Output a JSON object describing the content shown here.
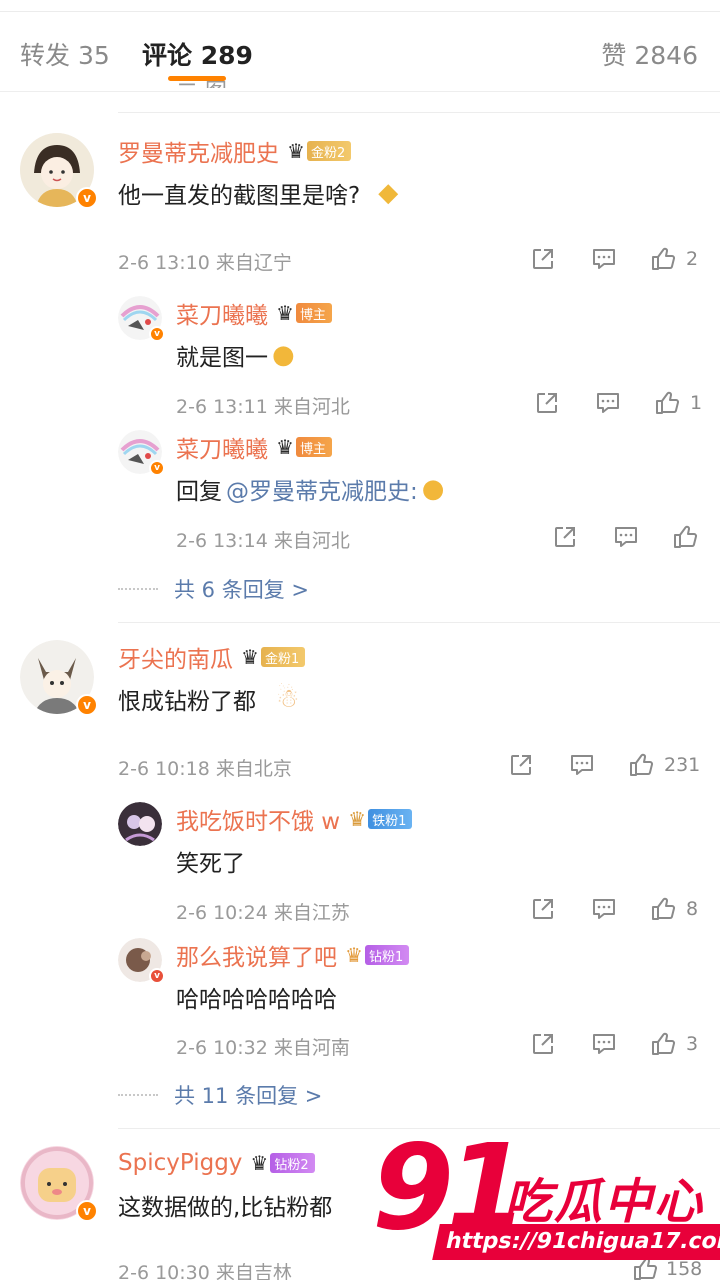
{
  "tabs": {
    "repost": "转发 35",
    "comment": "评论 289",
    "like": "赞 2846"
  },
  "cut_text": "二 图 一",
  "comments": [
    {
      "name": "罗曼蒂克减肥史",
      "badge": "金粉2",
      "text": "他一直发的截图里是啥?",
      "meta": "2-6 13:10 来自辽宁",
      "likes": "2",
      "replies": [
        {
          "name": "菜刀曦曦",
          "badge": "博主",
          "text": "就是图一",
          "meta": "2-6 13:11 来自河北",
          "likes": "1"
        },
        {
          "name": "菜刀曦曦",
          "badge": "博主",
          "text_prefix": "回复",
          "mention": "@罗曼蒂克减肥史:",
          "meta": "2-6 13:14 来自河北",
          "likes": ""
        }
      ],
      "more": "共 6 条回复 >"
    },
    {
      "name": "牙尖的南瓜",
      "badge": "金粉1",
      "text": "恨成钻粉了都",
      "meta": "2-6 10:18 来自北京",
      "likes": "231",
      "replies": [
        {
          "name": "我吃饭时不饿 w",
          "badge": "铁粉1",
          "text": "笑死了",
          "meta": "2-6 10:24 来自江苏",
          "likes": "8"
        },
        {
          "name": "那么我说算了吧",
          "badge": "钻粉1",
          "text": "哈哈哈哈哈哈哈",
          "meta": "2-6 10:32 来自河南",
          "likes": "3"
        }
      ],
      "more": "共 11 条回复 >"
    },
    {
      "name": "SpicyPiggy",
      "badge": "钻粉2",
      "text": "这数据做的,比钻粉都",
      "meta": "2-6 10:30 来自吉林",
      "likes": "158"
    }
  ],
  "watermark": {
    "number": "91",
    "cn": "吃瓜中心",
    "url": "https://91chigua17.com"
  },
  "icons": {
    "share": "share-icon",
    "reply": "comment-icon",
    "like": "thumb-up-icon",
    "crown": "crown-icon",
    "verified": "verified-v-icon"
  },
  "colors": {
    "accent": "#ff8200",
    "username": "#eb7350",
    "mention": "#5b7bab",
    "meta": "#9a9a9a",
    "watermark": "#e8003a"
  }
}
